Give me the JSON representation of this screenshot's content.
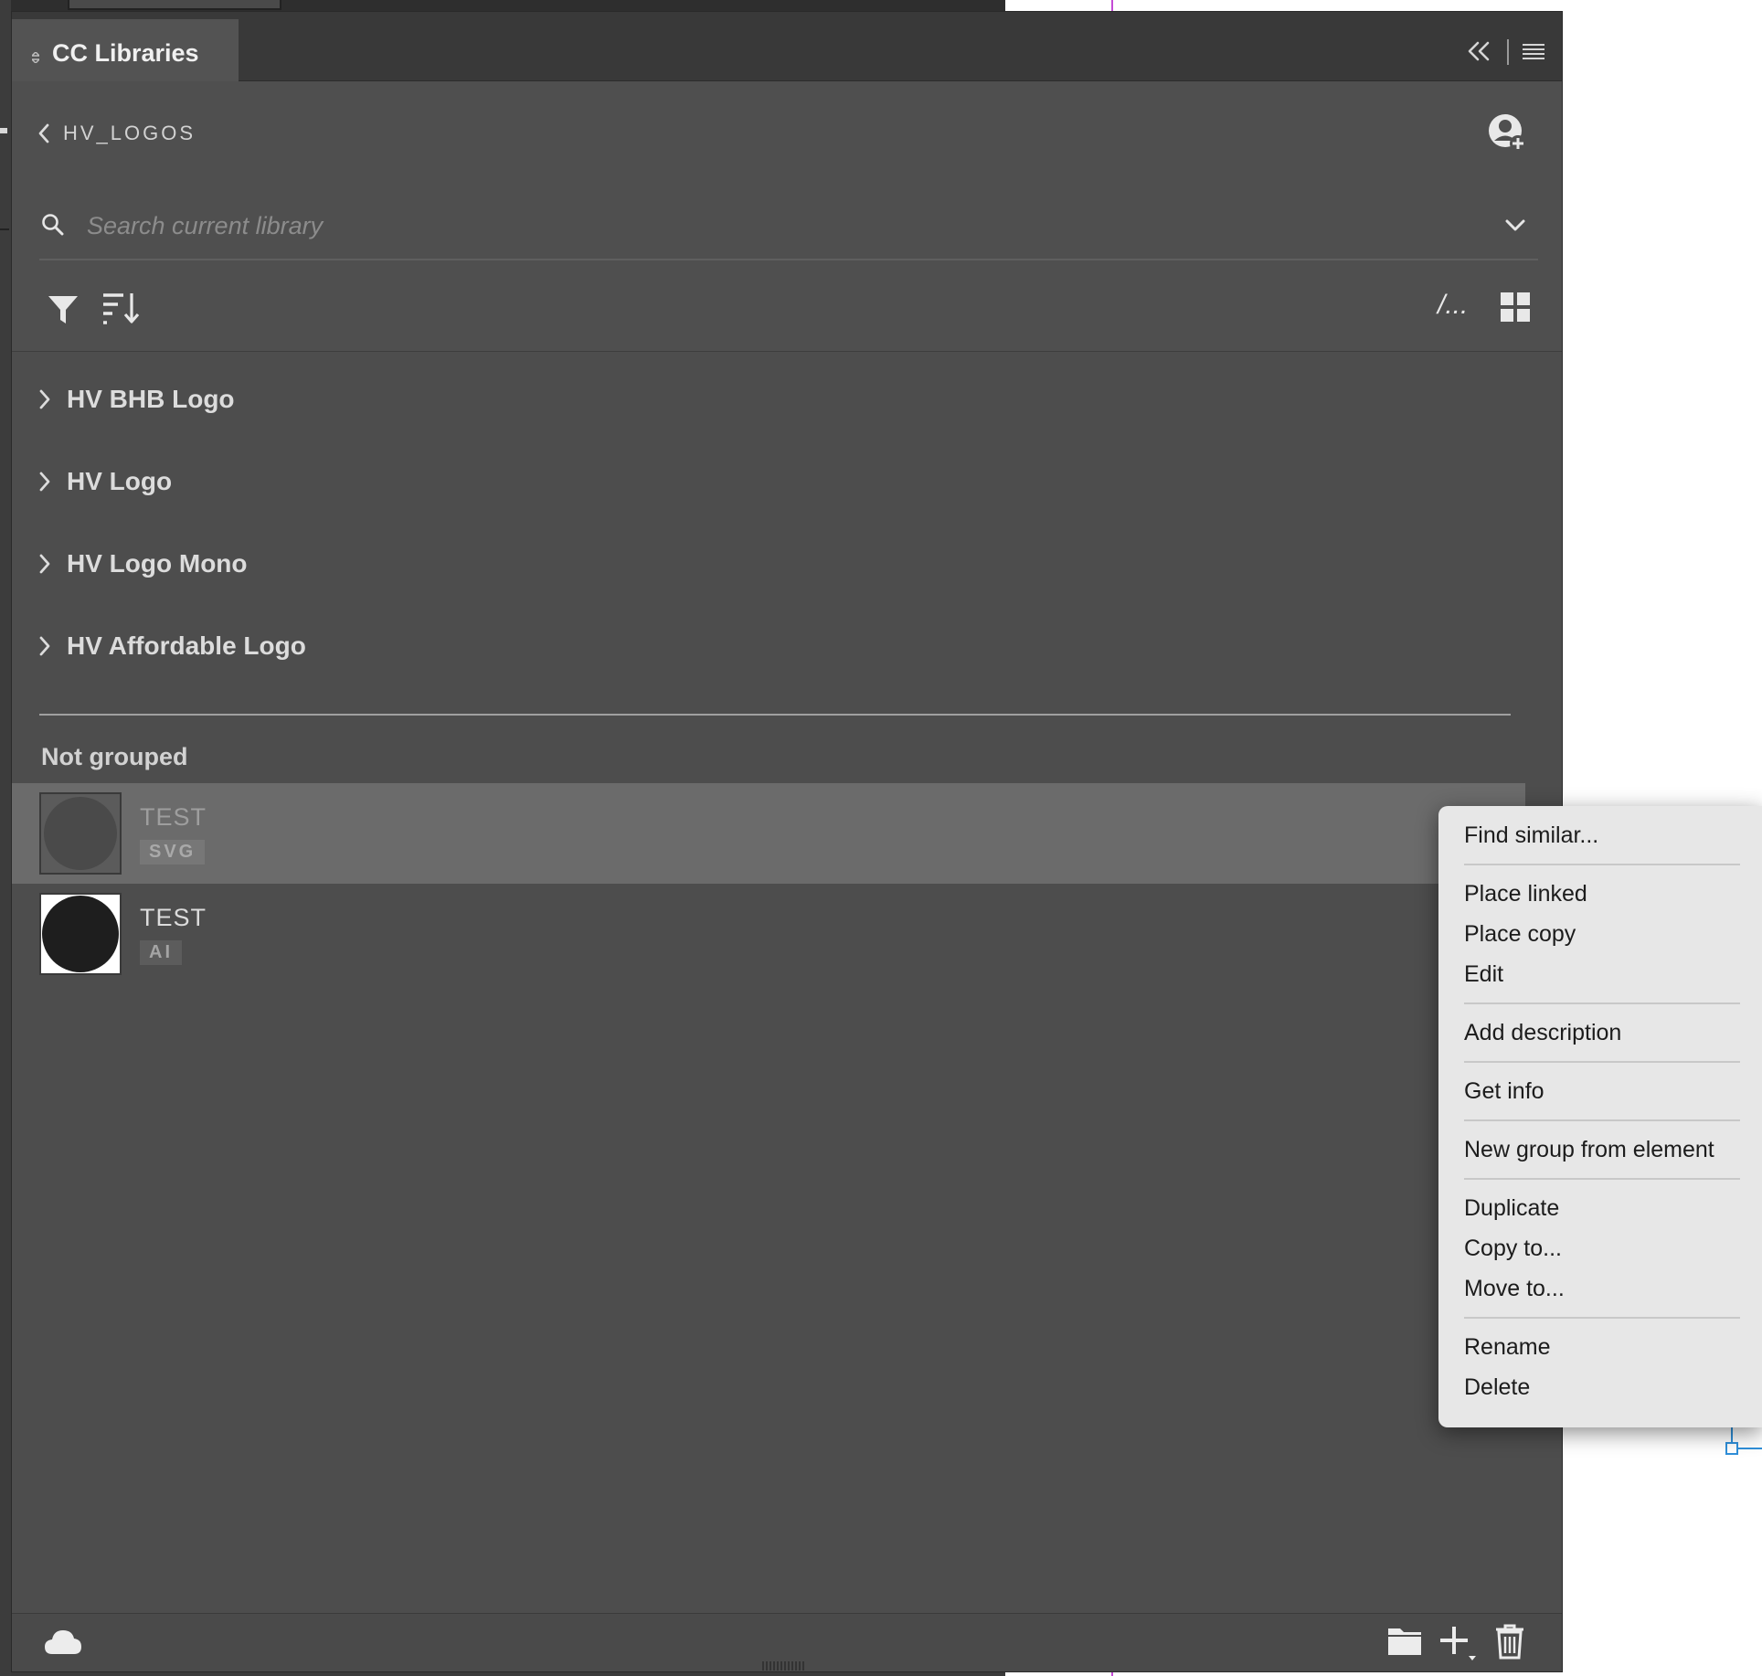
{
  "colors": {
    "panel_bg": "#4f4f4f",
    "tabbar_bg": "#393939",
    "selected_row": "#6b6b6b",
    "menu_bg": "#e7e7e7",
    "text_light": "#dcdcdc",
    "text_dark": "#1c1c1c",
    "selection_blue": "#2f8fd9"
  },
  "panel": {
    "tab_title": "CC Libraries",
    "icons": {
      "collapse": "double-chevron-left-icon",
      "menu": "hamburger-menu-icon"
    }
  },
  "breadcrumb": {
    "label": "HV_LOGOS",
    "icon": "chevron-left-icon"
  },
  "invite": {
    "icon": "invite-user-icon"
  },
  "search": {
    "placeholder": "Search current library",
    "value": "",
    "icon": "search-icon",
    "dropdown_icon": "chevron-down-icon"
  },
  "toolbar": {
    "filter_icon": "filter-icon",
    "sort_icon": "sort-icon",
    "path_label": "/...",
    "grid_icon": "grid-view-icon"
  },
  "groups": [
    {
      "label": "HV BHB Logo"
    },
    {
      "label": "HV Logo"
    },
    {
      "label": "HV Logo Mono"
    },
    {
      "label": "HV Affordable Logo"
    }
  ],
  "ungrouped": {
    "title": "Not grouped",
    "assets": [
      {
        "name": "TEST",
        "type": "SVG",
        "selected": true
      },
      {
        "name": "TEST",
        "type": "AI",
        "selected": false
      }
    ]
  },
  "footer": {
    "sync_icon": "cloud-icon",
    "new_group_icon": "folder-icon",
    "add_icon": "plus-icon",
    "delete_icon": "trash-icon"
  },
  "context_menu": {
    "items": [
      {
        "label": "Find similar..."
      },
      {
        "label": "Place linked"
      },
      {
        "label": "Place copy"
      },
      {
        "label": "Edit"
      },
      {
        "label": "Add description"
      },
      {
        "label": "Get info"
      },
      {
        "label": "New group from element"
      },
      {
        "label": "Duplicate"
      },
      {
        "label": "Copy to..."
      },
      {
        "label": "Move to..."
      },
      {
        "label": "Rename"
      },
      {
        "label": "Delete"
      }
    ]
  }
}
